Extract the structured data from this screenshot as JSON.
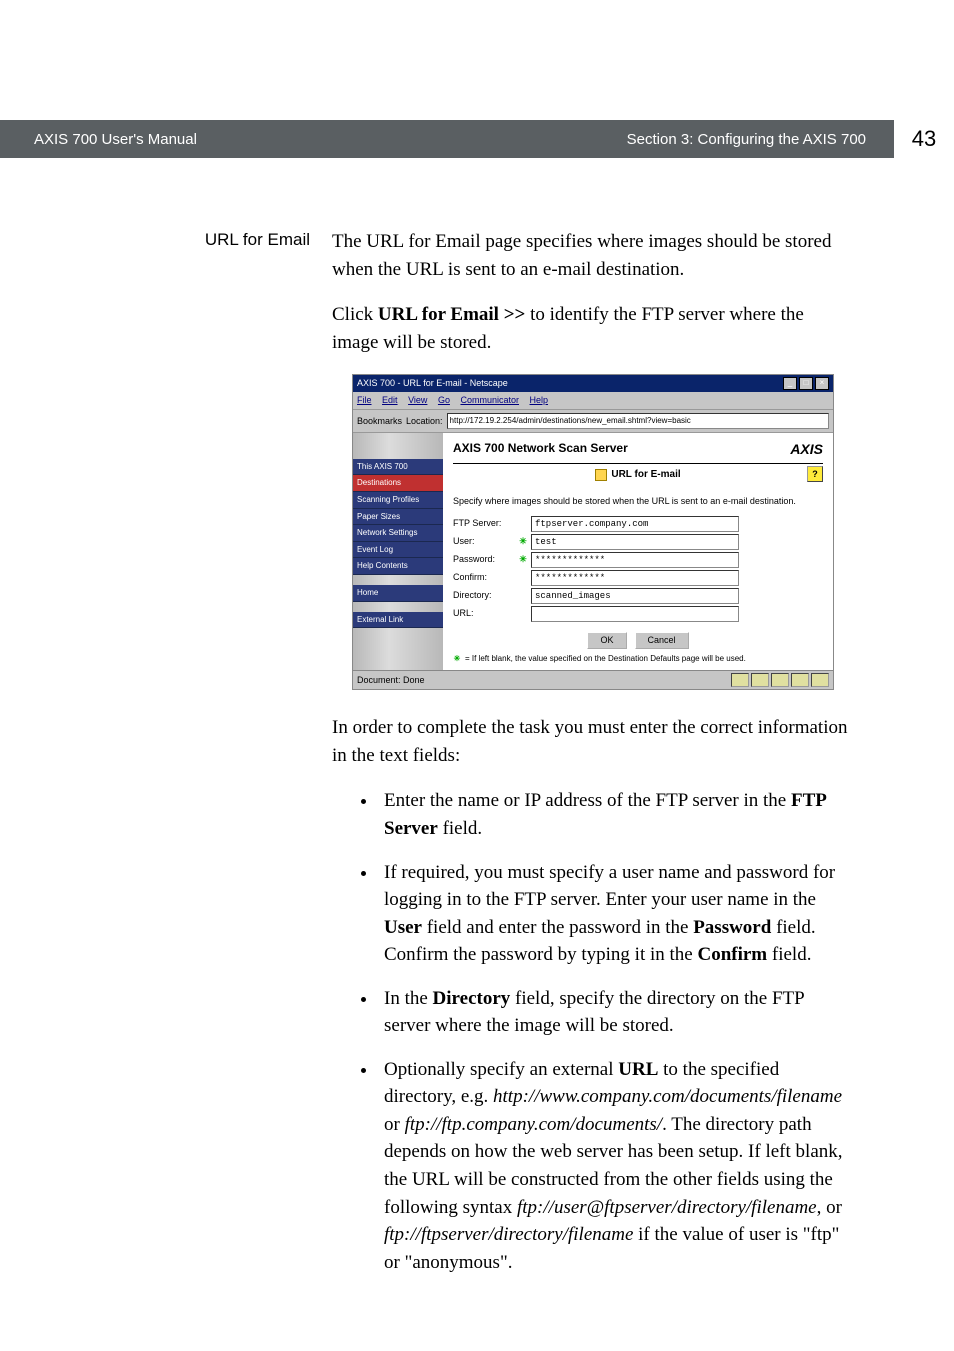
{
  "header": {
    "left": "AXIS 700 User's Manual",
    "right": "Section 3: Configuring the AXIS 700",
    "page_number": "43"
  },
  "side_label": "URL for Email",
  "para1": "The URL for Email page specifies where images should be stored when the URL is sent to an e-mail destination.",
  "para2_a": "Click ",
  "para2_b": "URL for Email >>",
  "para2_c": " to identify the FTP server where the image will be stored.",
  "screenshot": {
    "window_title": "AXIS 700 - URL for E-mail - Netscape",
    "menus": {
      "file": "File",
      "edit": "Edit",
      "view": "View",
      "go": "Go",
      "comm": "Communicator",
      "help": "Help"
    },
    "bookmarks_label": "Bookmarks",
    "location_label": "Location:",
    "location_value": "http://172.19.2.254/admin/destinations/new_email.shtml?view=basic",
    "brand": "AXIS 700 Network Scan Server",
    "logo": "AXIS",
    "page_title": "URL for E-mail",
    "help_btn": "?",
    "sidebar": {
      "s0": "This AXIS 700",
      "s1": "Destinations",
      "s2": "Scanning Profiles",
      "s3": "Paper Sizes",
      "s4": "Network Settings",
      "s5": "Event Log",
      "s6": "Help Contents",
      "s7": "Home",
      "s8": "External Link"
    },
    "description": "Specify where images should be stored when the URL is sent to an e-mail destination.",
    "labels": {
      "ftp": "FTP Server:",
      "user": "User:",
      "password": "Password:",
      "confirm": "Confirm:",
      "directory": "Directory:",
      "url": "URL:"
    },
    "values": {
      "ftp": "ftpserver.company.com",
      "user": "test",
      "password": "*************",
      "confirm": "*************",
      "directory": "scanned_images",
      "url": ""
    },
    "buttons": {
      "ok": "OK",
      "cancel": "Cancel"
    },
    "footnote_marker": "✳",
    "footnote": "= If left blank, the value specified on the Destination Defaults page will be used.",
    "status": "Document: Done"
  },
  "para3": "In order to complete the task you must enter the correct information in the text fields:",
  "bullets": {
    "b1_a": "Enter the name or IP address of the FTP server in the ",
    "b1_b": "FTP Server",
    "b1_c": " field.",
    "b2_a": "If required, you must specify a user name and password for logging in to the FTP server. Enter your user name in the ",
    "b2_b": "User",
    "b2_c": " field and enter the password in the ",
    "b2_d": "Password",
    "b2_e": " field. Confirm the password by typing it in the ",
    "b2_f": "Confirm",
    "b2_g": " field.",
    "b3_a": "In the ",
    "b3_b": "Directory",
    "b3_c": " field, specify the directory on the FTP server where the image will be stored.",
    "b4_a": "Optionally specify an external ",
    "b4_b": "URL",
    "b4_c": " to the specified directory, e.g. ",
    "b4_d": "http://www.company.com/documents/filename",
    "b4_e": " or ",
    "b4_f": "ftp://ftp.company.com/documents/",
    "b4_g": ". The directory path depends on how the web server has been setup. If left blank, the URL will be constructed from the other fields using the following syntax ",
    "b4_h": "ftp://user@ftpserver/directory/filename",
    "b4_i": ", or ",
    "b4_j": "ftp://ftpserver/directory/filename",
    "b4_k": " if the value of user is \"ftp\" or \"anonymous\"."
  }
}
